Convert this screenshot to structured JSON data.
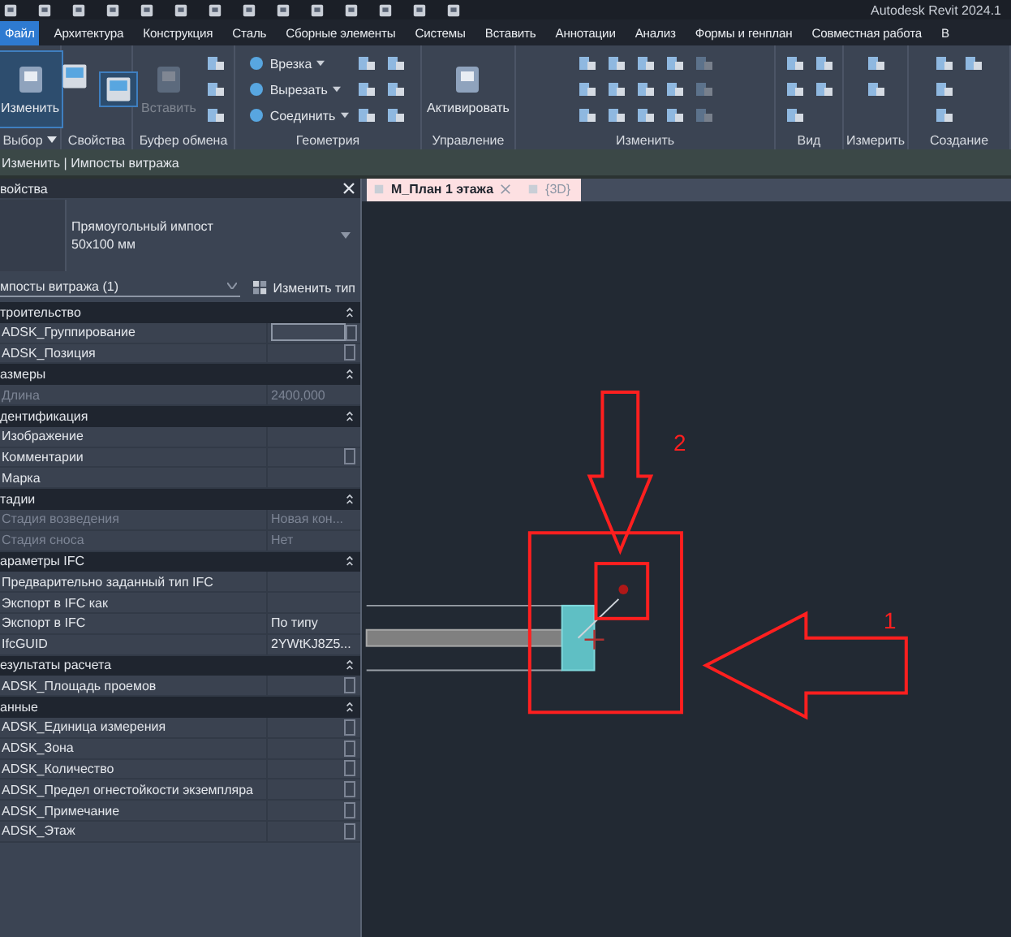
{
  "window": {
    "title": "Autodesk Revit 2024.1"
  },
  "menu_tabs": [
    {
      "label": "Файл",
      "selected": true
    },
    {
      "label": "Архитектура",
      "selected": false
    },
    {
      "label": "Конструкция",
      "selected": false
    },
    {
      "label": "Сталь",
      "selected": false
    },
    {
      "label": "Сборные элементы",
      "selected": false
    },
    {
      "label": "Системы",
      "selected": false
    },
    {
      "label": "Вставить",
      "selected": false
    },
    {
      "label": "Аннотации",
      "selected": false
    },
    {
      "label": "Анализ",
      "selected": false
    },
    {
      "label": "Формы и генплан",
      "selected": false
    },
    {
      "label": "Совместная работа",
      "selected": false
    },
    {
      "label": "В",
      "selected": false
    }
  ],
  "ribbon": [
    {
      "label": "Выбор",
      "has_menu": true,
      "tools": [
        {
          "kind": "large",
          "label": "Изменить",
          "selected": true,
          "disabled": false
        }
      ]
    },
    {
      "label": "Свойства",
      "tools": [
        {
          "kind": "tall",
          "selected": false,
          "disabled": false
        },
        {
          "kind": "tall",
          "selected": true,
          "disabled": false
        }
      ]
    },
    {
      "label": "Буфер обмена",
      "tools": [
        {
          "kind": "large",
          "label": "Вставить",
          "selected": false,
          "disabled": true
        },
        {
          "kind": "icon",
          "selected": false,
          "disabled": false
        },
        {
          "kind": "icon",
          "selected": false,
          "disabled": false
        },
        {
          "kind": "icon",
          "selected": false,
          "disabled": false
        }
      ]
    },
    {
      "label": "Геометрия",
      "tools": [
        {
          "kind": "small",
          "label": "Врезка",
          "selected": false,
          "disabled": false
        },
        {
          "kind": "small",
          "label": "Вырезать",
          "selected": false,
          "disabled": false
        },
        {
          "kind": "small",
          "label": "Соединить",
          "selected": false,
          "disabled": false
        },
        {
          "kind": "icon",
          "selected": false,
          "disabled": false
        },
        {
          "kind": "icon",
          "selected": false,
          "disabled": false
        },
        {
          "kind": "icon",
          "selected": false,
          "disabled": false
        },
        {
          "kind": "icon",
          "selected": false,
          "disabled": false
        },
        {
          "kind": "icon",
          "selected": false,
          "disabled": false
        },
        {
          "kind": "icon",
          "selected": false,
          "disabled": false
        }
      ]
    },
    {
      "label": "Управление",
      "tools": [
        {
          "kind": "large",
          "label": "Активировать",
          "selected": false,
          "disabled": false
        }
      ]
    },
    {
      "label": "Изменить",
      "tools": [
        {
          "kind": "icon",
          "selected": false,
          "disabled": false
        },
        {
          "kind": "icon",
          "selected": false,
          "disabled": false
        },
        {
          "kind": "icon",
          "selected": false,
          "disabled": false
        },
        {
          "kind": "icon",
          "selected": false,
          "disabled": false
        },
        {
          "kind": "icon",
          "selected": false,
          "disabled": false
        },
        {
          "kind": "icon",
          "selected": false,
          "disabled": false
        },
        {
          "kind": "icon",
          "selected": false,
          "disabled": false
        },
        {
          "kind": "icon",
          "selected": false,
          "disabled": false
        },
        {
          "kind": "icon",
          "selected": false,
          "disabled": false
        },
        {
          "kind": "icon",
          "selected": false,
          "disabled": false
        },
        {
          "kind": "icon",
          "selected": false,
          "disabled": false
        },
        {
          "kind": "icon",
          "selected": false,
          "disabled": false
        },
        {
          "kind": "icon",
          "selected": false,
          "disabled": true
        },
        {
          "kind": "icon",
          "selected": false,
          "disabled": true
        },
        {
          "kind": "icon",
          "selected": false,
          "disabled": true
        }
      ]
    },
    {
      "label": "Вид",
      "tools": [
        {
          "kind": "icon",
          "selected": false,
          "disabled": false
        },
        {
          "kind": "icon",
          "selected": false,
          "disabled": false
        },
        {
          "kind": "icon",
          "selected": false,
          "disabled": false
        },
        {
          "kind": "icon",
          "selected": false,
          "disabled": false
        },
        {
          "kind": "icon",
          "selected": false,
          "disabled": false
        }
      ]
    },
    {
      "label": "Измерить",
      "tools": [
        {
          "kind": "icon",
          "selected": false,
          "disabled": false
        },
        {
          "kind": "icon",
          "selected": false,
          "disabled": false
        }
      ]
    },
    {
      "label": "Создание",
      "tools": [
        {
          "kind": "icon",
          "selected": false,
          "disabled": false
        },
        {
          "kind": "icon",
          "selected": false,
          "disabled": false
        },
        {
          "kind": "icon",
          "selected": false,
          "disabled": false
        },
        {
          "kind": "icon",
          "selected": false,
          "disabled": false
        }
      ]
    }
  ],
  "context_bar": "Изменить | Импосты витража",
  "properties": {
    "title": "войства",
    "type_name": "Прямоугольный импост",
    "type_size": "50x100 мм",
    "instance_filter": "мпосты витража (1)",
    "edit_type_button": "Изменить тип",
    "groups": [
      {
        "title": "троительство",
        "expanded": true,
        "rows": [
          {
            "name": "ADSK_Группирование",
            "disabled": false,
            "focused": true,
            "param_button": true
          },
          {
            "name": "ADSK_Позиция",
            "disabled": false,
            "focused": false,
            "param_button": true
          }
        ]
      },
      {
        "title": "азмеры",
        "expanded": true,
        "rows": [
          {
            "name": "Длина",
            "value": "2400,000",
            "disabled": true,
            "focused": false,
            "param_button": false
          }
        ]
      },
      {
        "title": "дентификация",
        "expanded": true,
        "rows": [
          {
            "name": "Изображение",
            "disabled": false,
            "focused": false,
            "param_button": false
          },
          {
            "name": "Комментарии",
            "disabled": false,
            "focused": false,
            "param_button": true
          },
          {
            "name": "Марка",
            "disabled": false,
            "focused": false,
            "param_button": false
          }
        ]
      },
      {
        "title": "тадии",
        "expanded": true,
        "rows": [
          {
            "name": "Стадия возведения",
            "value": "Новая кон...",
            "disabled": true,
            "focused": false,
            "param_button": false
          },
          {
            "name": "Стадия сноса",
            "value": "Нет",
            "disabled": true,
            "focused": false,
            "param_button": false
          }
        ]
      },
      {
        "title": "араметры IFC",
        "expanded": true,
        "rows": [
          {
            "name": "Предварительно заданный тип IFC",
            "disabled": false,
            "focused": false,
            "param_button": false
          },
          {
            "name": "Экспорт в IFC как",
            "disabled": false,
            "focused": false,
            "param_button": false
          },
          {
            "name": "Экспорт в IFC",
            "value": "По типу",
            "disabled": false,
            "focused": false,
            "param_button": false
          },
          {
            "name": "IfcGUID",
            "value": "2YWtKJ8Z5...",
            "disabled": false,
            "focused": false,
            "param_button": false
          }
        ]
      },
      {
        "title": "езультаты расчета",
        "expanded": true,
        "rows": [
          {
            "name": "ADSK_Площадь проемов",
            "disabled": false,
            "focused": false,
            "param_button": true
          }
        ]
      },
      {
        "title": "анные",
        "expanded": true,
        "rows": [
          {
            "name": "ADSK_Единица измерения",
            "disabled": false,
            "focused": false,
            "param_button": true
          },
          {
            "name": "ADSK_Зона",
            "disabled": false,
            "focused": false,
            "param_button": true
          },
          {
            "name": "ADSK_Количество",
            "disabled": false,
            "focused": false,
            "param_button": true
          },
          {
            "name": "ADSK_Предел огнестойкости экземпляра",
            "disabled": false,
            "focused": false,
            "param_button": true
          },
          {
            "name": "ADSK_Примечание",
            "disabled": false,
            "focused": false,
            "param_button": true
          },
          {
            "name": "ADSK_Этаж",
            "disabled": false,
            "focused": false,
            "param_button": true
          }
        ]
      }
    ]
  },
  "view_tabs": [
    {
      "label": "М_План 1 этажа",
      "selected": true
    },
    {
      "label": "{3D}",
      "selected": false
    }
  ],
  "annotations": [
    {
      "label": "1"
    },
    {
      "label": "2"
    }
  ]
}
